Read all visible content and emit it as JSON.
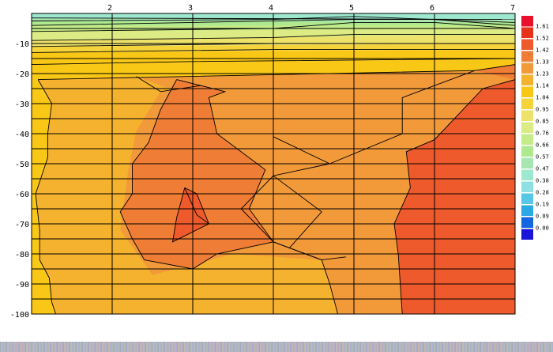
{
  "chart_data": {
    "type": "heatmap",
    "title": "",
    "xlabel": "",
    "ylabel": "",
    "x_ticks": [
      2,
      3,
      4,
      5,
      6,
      7
    ],
    "y_ticks": [
      -10,
      -20,
      -30,
      -40,
      -50,
      -60,
      -70,
      -80,
      -90,
      -100
    ],
    "xlim": [
      1,
      7
    ],
    "ylim": [
      -100,
      0
    ],
    "x_tick_position": "top",
    "y_axis_position": "left",
    "grid": true,
    "legend": {
      "placement": "right",
      "levels": [
        {
          "value": "1.61",
          "color": "#e8331b"
        },
        {
          "value": "1.52",
          "color": "#ee5a2b"
        },
        {
          "value": "1.42",
          "color": "#f07d35"
        },
        {
          "value": "1.33",
          "color": "#f29a3a"
        },
        {
          "value": "1.23",
          "color": "#f5b22e"
        },
        {
          "value": "1.14",
          "color": "#f9c715"
        },
        {
          "value": "1.04",
          "color": "#f5d33a"
        },
        {
          "value": "0.95",
          "color": "#ede36b"
        },
        {
          "value": "0.85",
          "color": "#dceb84"
        },
        {
          "value": "0.76",
          "color": "#c5ec88"
        },
        {
          "value": "0.66",
          "color": "#aee88f"
        },
        {
          "value": "0.57",
          "color": "#a7e5b1"
        },
        {
          "value": "0.47",
          "color": "#9ee8cf"
        },
        {
          "value": "0.38",
          "color": "#8fe0e3"
        },
        {
          "value": "0.28",
          "color": "#56c7e6"
        },
        {
          "value": "0.19",
          "color": "#2aa9e5"
        },
        {
          "value": "0.09",
          "color": "#1467e0"
        },
        {
          "value": "0.00",
          "color": "#1a14d8"
        }
      ],
      "top_swatch_color": "#e8102a"
    },
    "regions": [
      {
        "level": "1.14",
        "points": [
          [
            1,
            -100
          ],
          [
            1,
            -17
          ],
          [
            7,
            -15
          ],
          [
            7,
            -100
          ]
        ]
      },
      {
        "level": "1.23",
        "points": [
          [
            1.08,
            -22
          ],
          [
            6.5,
            -19
          ],
          [
            7,
            -17
          ],
          [
            7,
            -100
          ],
          [
            4.8,
            -100
          ],
          [
            1.3,
            -100
          ],
          [
            1.25,
            -96
          ],
          [
            1.22,
            -88
          ],
          [
            1.1,
            -82
          ],
          [
            1.1,
            -72
          ],
          [
            1.05,
            -60
          ],
          [
            1.2,
            -48
          ],
          [
            1.2,
            -40
          ],
          [
            1.25,
            -30
          ],
          [
            1.08,
            -22
          ]
        ]
      },
      {
        "level": "1.33",
        "points": [
          [
            1.08,
            -22
          ],
          [
            6.5,
            -19
          ],
          [
            7,
            -17
          ],
          [
            7,
            -100
          ],
          [
            4.8,
            -100
          ],
          [
            4.7,
            -90
          ],
          [
            4.6,
            -82
          ],
          [
            3.5,
            -80
          ],
          [
            2.5,
            -87
          ],
          [
            2.1,
            -72
          ],
          [
            2.2,
            -52
          ],
          [
            2.3,
            -39
          ],
          [
            2.6,
            -26
          ],
          [
            3.1,
            -24
          ],
          [
            3.5,
            -28
          ],
          [
            4,
            -41
          ],
          [
            4,
            -54
          ],
          [
            4.6,
            -66
          ],
          [
            4.2,
            -78
          ],
          [
            4,
            -76
          ],
          [
            3.6,
            -65
          ],
          [
            3.9,
            -50
          ],
          [
            3.4,
            -40
          ],
          [
            3.2,
            -30
          ],
          [
            2.3,
            -21
          ]
        ]
      },
      {
        "level": "1.42",
        "points": [
          [
            6.5,
            -19
          ],
          [
            7,
            -17
          ],
          [
            7,
            -100
          ],
          [
            5.6,
            -100
          ],
          [
            5.55,
            -80
          ],
          [
            5.5,
            -70
          ],
          [
            5.7,
            -58
          ],
          [
            5.65,
            -46
          ],
          [
            6,
            -42
          ],
          [
            6.6,
            -25
          ],
          [
            7,
            -22
          ]
        ]
      },
      {
        "level": "1.42",
        "points": [
          [
            2.25,
            -50
          ],
          [
            2.25,
            -60
          ],
          [
            2.1,
            -66
          ],
          [
            2.25,
            -75
          ],
          [
            2.4,
            -82
          ],
          [
            3,
            -85
          ],
          [
            3.3,
            -80
          ],
          [
            4,
            -76
          ],
          [
            3.7,
            -65
          ],
          [
            3.9,
            -52
          ],
          [
            3.3,
            -40
          ],
          [
            3.2,
            -28
          ],
          [
            3.4,
            -26
          ],
          [
            2.8,
            -22
          ],
          [
            2.6,
            -32
          ],
          [
            2.45,
            -43
          ]
        ]
      },
      {
        "level": "1.52",
        "points": [
          [
            7,
            -22
          ],
          [
            6.6,
            -25
          ],
          [
            6,
            -42
          ],
          [
            5.65,
            -46
          ],
          [
            5.7,
            -58
          ],
          [
            5.5,
            -70
          ],
          [
            5.55,
            -80
          ],
          [
            5.6,
            -100
          ],
          [
            7,
            -100
          ]
        ]
      },
      {
        "level": "1.52",
        "points": [
          [
            2.9,
            -58
          ],
          [
            2.8,
            -68
          ],
          [
            2.75,
            -76
          ],
          [
            3.2,
            -70
          ],
          [
            3.05,
            -60
          ]
        ]
      },
      {
        "level": "1.14",
        "points": [
          [
            1,
            -13
          ],
          [
            7,
            -12
          ],
          [
            7,
            -15
          ],
          [
            1,
            -17
          ]
        ]
      },
      {
        "level": "1.04",
        "points": [
          [
            1,
            -11
          ],
          [
            7,
            -10
          ],
          [
            7,
            -12
          ],
          [
            1,
            -13
          ]
        ]
      },
      {
        "level": "0.95",
        "points": [
          [
            1,
            -9
          ],
          [
            5,
            -7
          ],
          [
            7,
            -7
          ],
          [
            7,
            -10
          ],
          [
            1,
            -11
          ]
        ]
      },
      {
        "level": "0.85",
        "points": [
          [
            1,
            -6
          ],
          [
            4,
            -5
          ],
          [
            5,
            -3
          ],
          [
            7,
            -5
          ],
          [
            7,
            -7
          ],
          [
            1,
            -9
          ]
        ]
      },
      {
        "level": "0.76",
        "points": [
          [
            1,
            -4
          ],
          [
            5,
            -2
          ],
          [
            7,
            -4
          ],
          [
            7,
            -5
          ],
          [
            1,
            -6
          ]
        ]
      },
      {
        "level": "0.66",
        "points": [
          [
            1,
            -2.5
          ],
          [
            5,
            -1
          ],
          [
            7,
            -3
          ],
          [
            7,
            -4
          ],
          [
            1,
            -4
          ]
        ]
      },
      {
        "level": "0.57",
        "points": [
          [
            1,
            -1.5
          ],
          [
            7,
            -2
          ],
          [
            7,
            -3
          ],
          [
            1,
            -2.5
          ]
        ]
      },
      {
        "level": "0.47",
        "points": [
          [
            1,
            0
          ],
          [
            7,
            0
          ],
          [
            7,
            -2
          ],
          [
            1,
            -1.5
          ]
        ]
      }
    ],
    "contour_lines": [
      [
        [
          1,
          -17
        ],
        [
          3,
          -16
        ],
        [
          7,
          -15
        ]
      ],
      [
        [
          1,
          -13
        ],
        [
          4,
          -12
        ],
        [
          7,
          -12
        ]
      ],
      [
        [
          1,
          -11
        ],
        [
          4,
          -10
        ],
        [
          7,
          -10
        ]
      ],
      [
        [
          1,
          -9
        ],
        [
          4,
          -8
        ],
        [
          5,
          -7
        ],
        [
          7,
          -7
        ]
      ],
      [
        [
          1,
          -6
        ],
        [
          4,
          -5
        ],
        [
          5,
          -3
        ],
        [
          6,
          -3
        ],
        [
          7,
          -5
        ]
      ],
      [
        [
          1,
          -4
        ],
        [
          3,
          -3
        ],
        [
          5,
          -2
        ],
        [
          6,
          -2
        ],
        [
          7,
          -4
        ]
      ],
      [
        [
          1,
          -2.5
        ],
        [
          4,
          -2
        ],
        [
          5,
          -1
        ],
        [
          7,
          -3
        ]
      ],
      [
        [
          1,
          -1.5
        ],
        [
          7,
          -2
        ]
      ],
      [
        [
          1.08,
          -22
        ],
        [
          6.5,
          -19
        ],
        [
          7,
          -17
        ]
      ],
      [
        [
          1.08,
          -22
        ],
        [
          1.25,
          -30
        ],
        [
          1.2,
          -40
        ],
        [
          1.2,
          -48
        ],
        [
          1.05,
          -60
        ],
        [
          1.1,
          -72
        ],
        [
          1.1,
          -82
        ],
        [
          1.22,
          -88
        ],
        [
          1.25,
          -96
        ],
        [
          1.3,
          -100
        ]
      ],
      [
        [
          2.3,
          -21
        ],
        [
          2.6,
          -26
        ],
        [
          3.1,
          -24
        ]
      ],
      [
        [
          7,
          -22
        ],
        [
          6.6,
          -25
        ],
        [
          6,
          -42
        ],
        [
          5.65,
          -46
        ],
        [
          5.7,
          -58
        ],
        [
          5.5,
          -70
        ],
        [
          5.55,
          -80
        ],
        [
          5.6,
          -100
        ]
      ],
      [
        [
          6.5,
          -19
        ],
        [
          5.6,
          -28
        ],
        [
          5.6,
          -40
        ],
        [
          4.7,
          -50
        ]
      ],
      [
        [
          4.7,
          -50
        ],
        [
          4,
          -54
        ]
      ],
      [
        [
          4,
          -54
        ],
        [
          4.6,
          -66
        ],
        [
          4.2,
          -78
        ],
        [
          4.6,
          -82
        ],
        [
          4.7,
          -90
        ],
        [
          4.8,
          -100
        ]
      ],
      [
        [
          2.8,
          -22
        ],
        [
          3.4,
          -26
        ],
        [
          3.2,
          -28
        ],
        [
          3.3,
          -40
        ],
        [
          3.9,
          -52
        ],
        [
          3.7,
          -65
        ],
        [
          4,
          -76
        ],
        [
          3.3,
          -80
        ],
        [
          3,
          -85
        ],
        [
          2.4,
          -82
        ],
        [
          2.25,
          -75
        ],
        [
          2.1,
          -66
        ],
        [
          2.25,
          -60
        ],
        [
          2.25,
          -50
        ],
        [
          2.45,
          -43
        ],
        [
          2.6,
          -32
        ],
        [
          2.8,
          -22
        ]
      ],
      [
        [
          2.9,
          -58
        ],
        [
          2.8,
          -68
        ],
        [
          2.75,
          -76
        ],
        [
          3.2,
          -70
        ],
        [
          3.05,
          -60
        ],
        [
          2.9,
          -58
        ]
      ],
      [
        [
          2.9,
          -58
        ],
        [
          3.05,
          -67
        ],
        [
          3.2,
          -70
        ]
      ],
      [
        [
          4,
          -41
        ],
        [
          4,
          -54
        ],
        [
          3.6,
          -65
        ],
        [
          4,
          -76
        ],
        [
          4.2,
          -78
        ]
      ],
      [
        [
          4,
          -41
        ],
        [
          4.7,
          -50
        ]
      ],
      [
        [
          4,
          -76
        ],
        [
          4.6,
          -82
        ],
        [
          4.9,
          -81
        ]
      ]
    ]
  }
}
